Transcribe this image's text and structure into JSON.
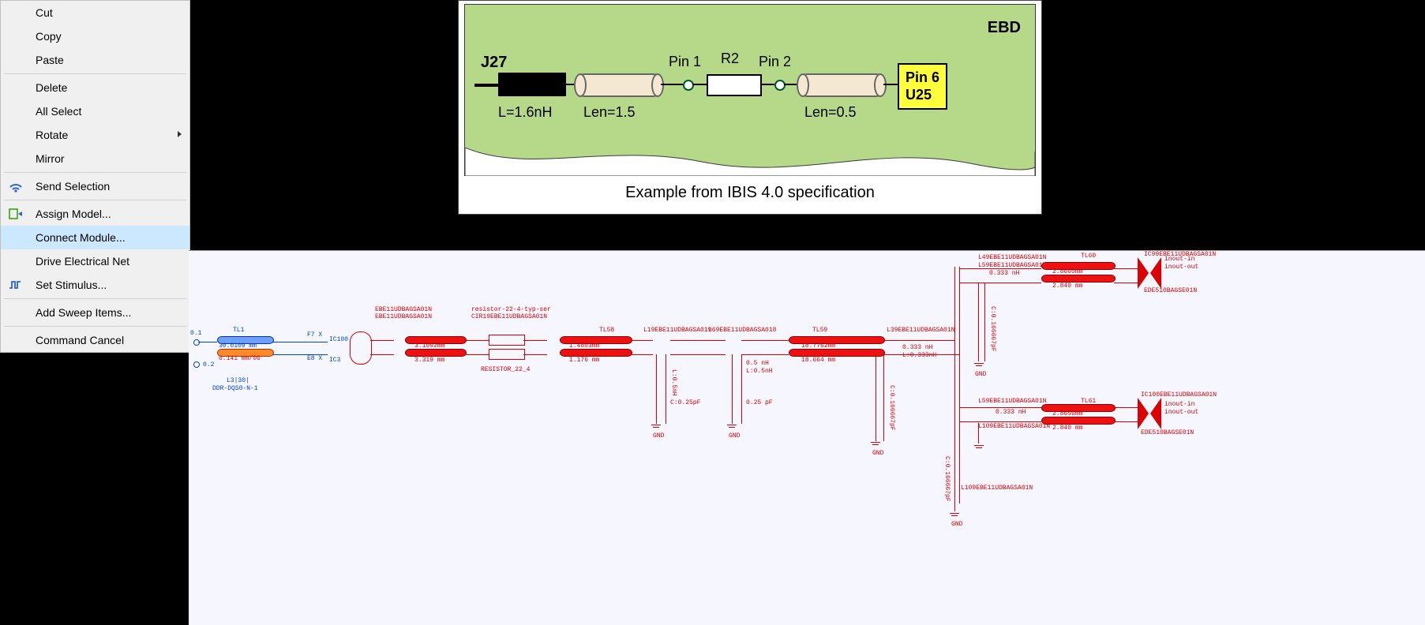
{
  "menu": {
    "cut": "Cut",
    "copy": "Copy",
    "paste": "Paste",
    "delete": "Delete",
    "all_select": "All Select",
    "rotate": "Rotate",
    "mirror": "Mirror",
    "send_selection": "Send Selection",
    "assign_model": "Assign Model...",
    "connect_module": "Connect Module...",
    "drive_electrical": "Drive Electrical Net",
    "set_stimulus": "Set Stimulus...",
    "add_sweep": "Add Sweep Items...",
    "cmd_cancel": "Command Cancel"
  },
  "ebd": {
    "title": "EBD",
    "conn": "J27",
    "l_val": "L=1.6nH",
    "len1": "Len=1.5",
    "pin1": "Pin 1",
    "r_name": "R2",
    "pin2": "Pin 2",
    "len2": "Len=0.5",
    "chip_pin": "Pin 6",
    "chip_ref": "U25",
    "caption": "Example from IBIS 4.0 specification"
  },
  "schematic": {
    "tl1": "TL1",
    "tl1_len_a": "30.0109 mm",
    "tl1_len_b": "0.141 mm/06",
    "net1": "L3|30|",
    "net2": "DDR-DQS0-N-1",
    "ic100": "IC100",
    "ic3": "IC3",
    "ebe_block": "EBE11UDBAGSA01N",
    "len_3109": "3.1092mm",
    "len_3319": "3.319 mm",
    "res_block": "resistor-22-4-typ-ser",
    "cir19": "CIR19EBE11UDBAGSA01N",
    "res_ref": "RESISTOR_22_4",
    "tl58": "TL58",
    "tl58_len": "1.4803mm",
    "tl58_len2": "1.176 mm",
    "l19": "L19EBE11UDBAGSA019",
    "l69": "L69EBE11UDBAGSA018",
    "lc_a": "L:0.5nH",
    "lc_b": "0.5 nH",
    "cap_a": "C:0.25pF",
    "cap_b": "0.25 pF",
    "tl59": "TL59",
    "tl59_len": "18.7762mm",
    "tl59_len2": "18.664 mm",
    "l39": "L39EBE11UDBAGSA01N",
    "l_333": "0.333 nH",
    "l_333b": "L:0.333nH",
    "c_166": "C:0.166667pF",
    "l49": "L49EBE11UDBAGSA01N",
    "l59": "L59EBE11UDBAGSA01N",
    "tl60": "TL60",
    "tl60_len": "2.8605mm",
    "tl60_len2": "2.840 mm",
    "ic99": "IC99EBE11UDBAGSA01N",
    "ede60": "EDE510BAGSE01N",
    "inout_in": "inout-in",
    "inout_out": "inout-out",
    "l109": "L109EBE11UDBAGSA01N",
    "tl61": "TL61",
    "tl61_len": "2.8656mm",
    "ic100r": "IC100EBE11UDBAGSA01N",
    "gnd": "GND"
  }
}
